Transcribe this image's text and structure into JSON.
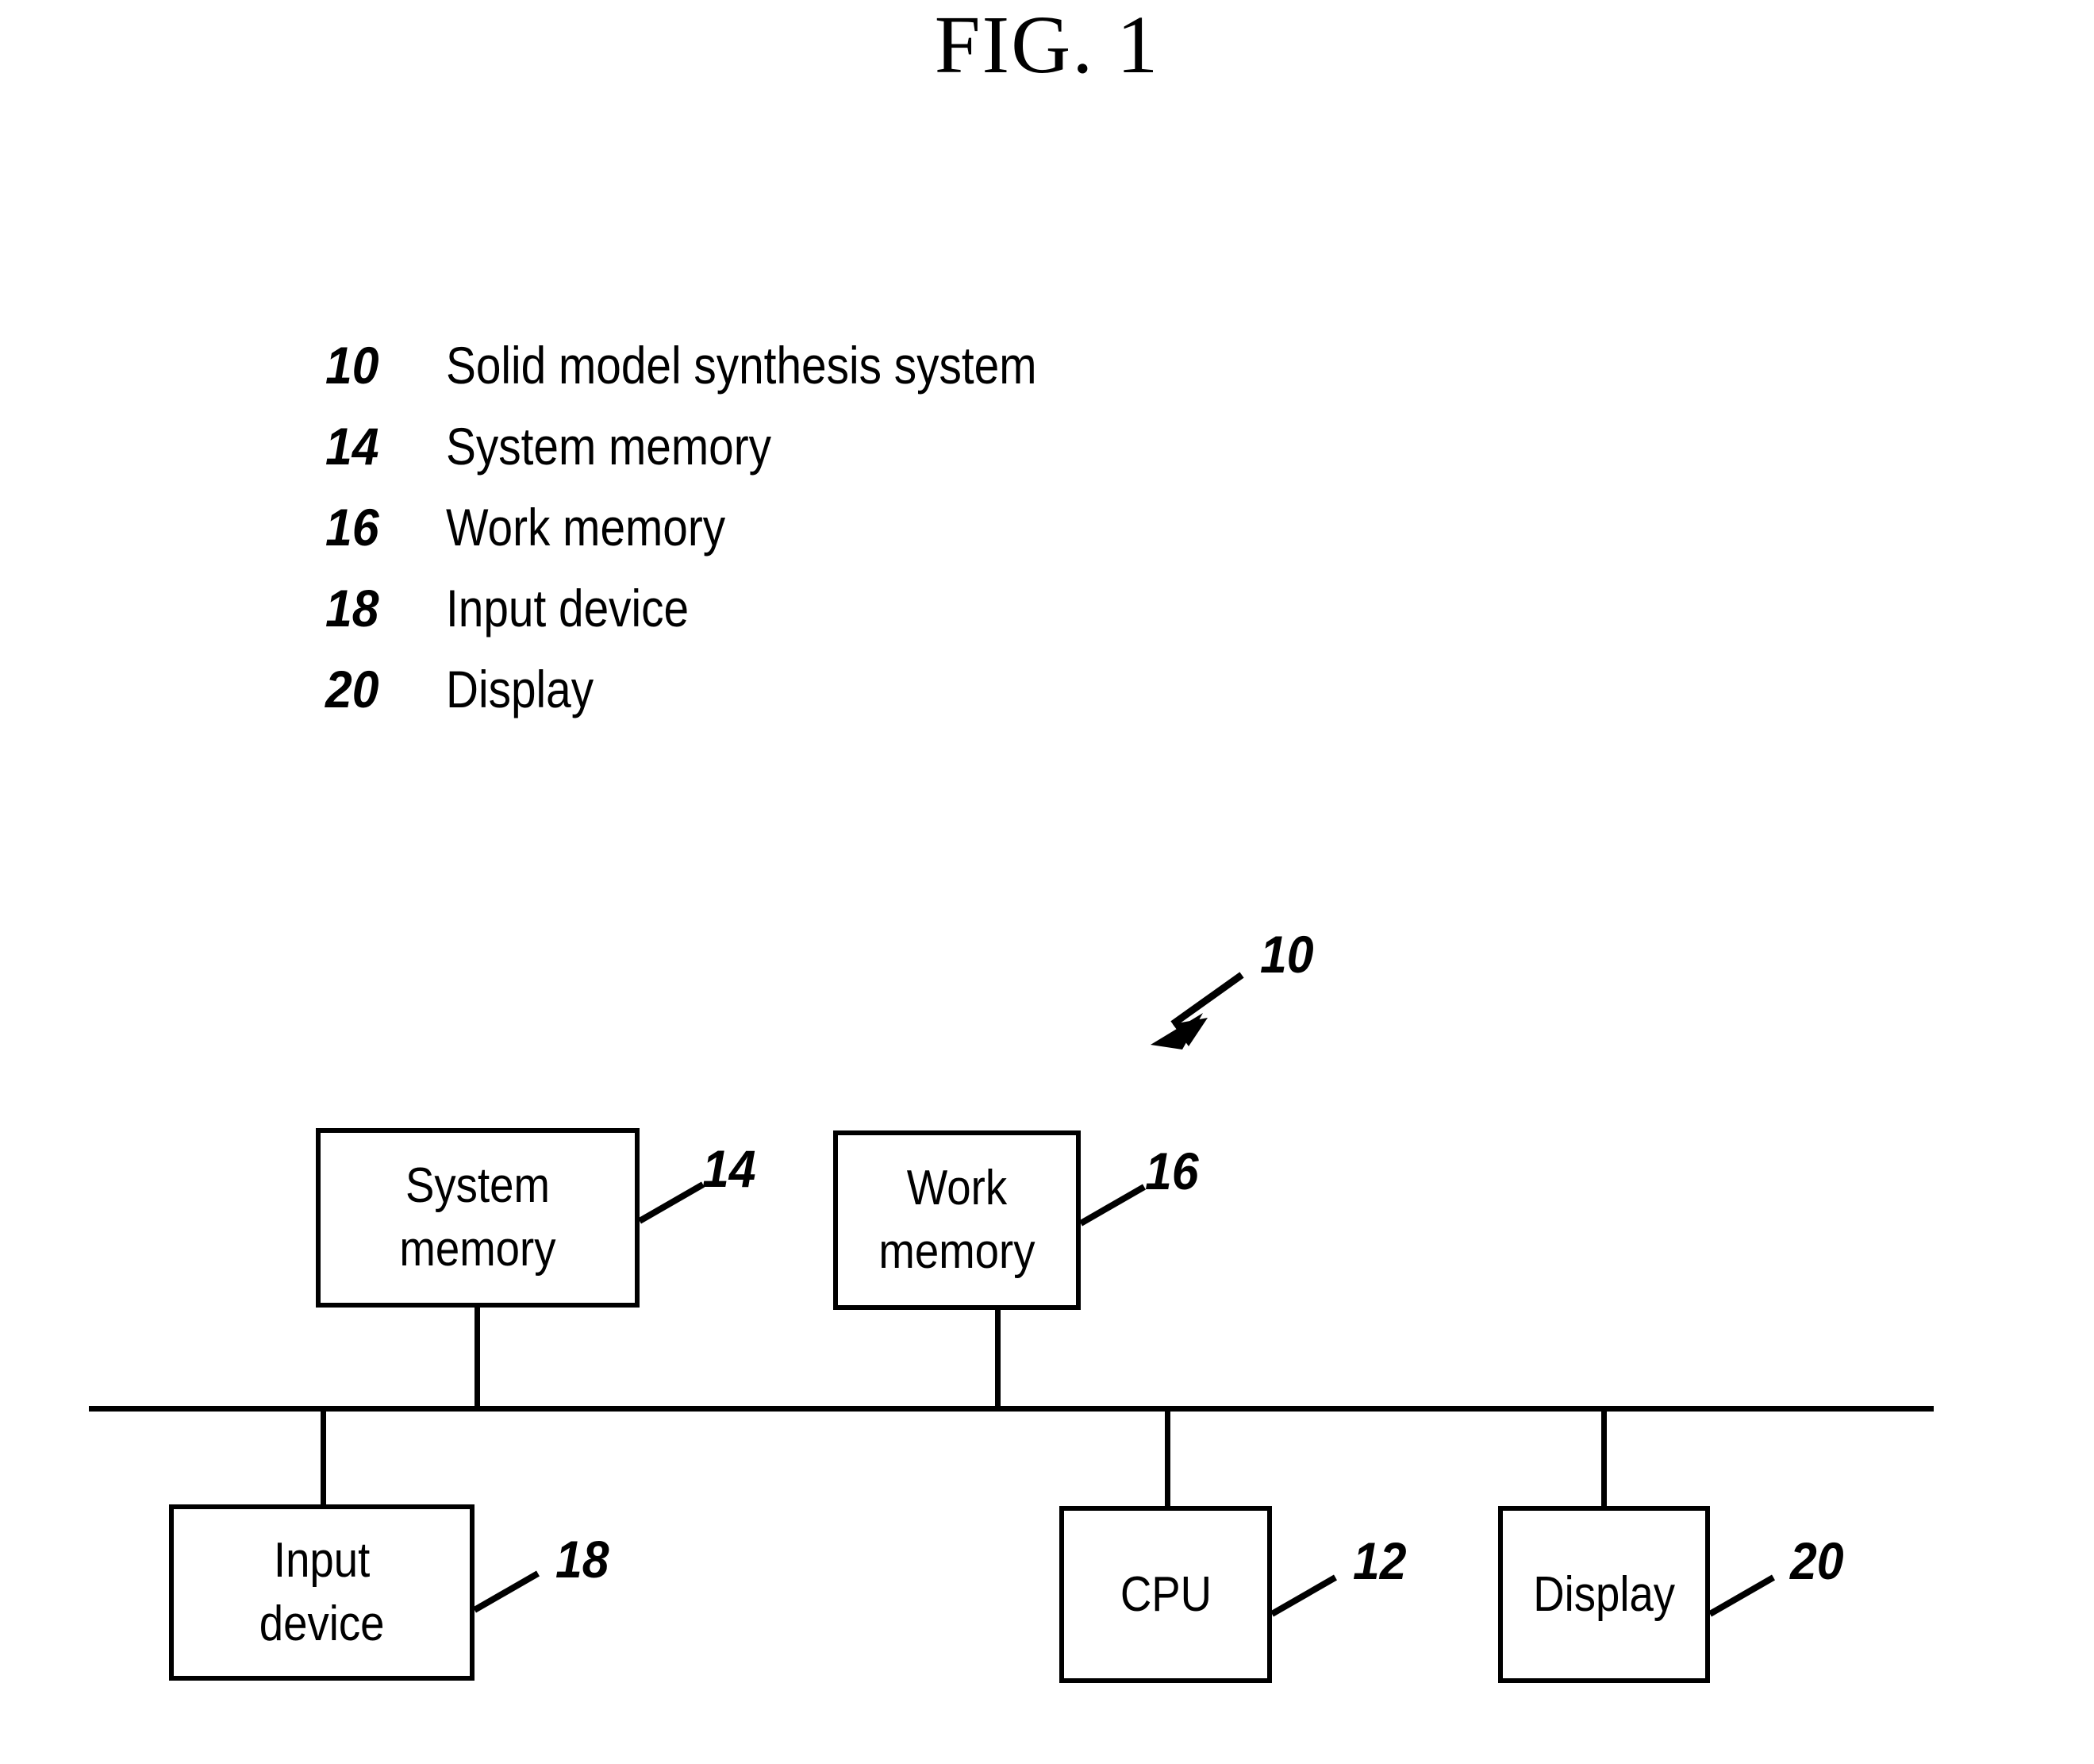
{
  "figure": {
    "title": "FIG. 1"
  },
  "legend": {
    "items": [
      {
        "number": "10",
        "label": "Solid model synthesis system"
      },
      {
        "number": "14",
        "label": "System memory"
      },
      {
        "number": "16",
        "label": "Work memory"
      },
      {
        "number": "18",
        "label": "Input device"
      },
      {
        "number": "20",
        "label": "Display"
      }
    ]
  },
  "diagram": {
    "system_callout": "10",
    "blocks": [
      {
        "label": "System\nmemory",
        "ref": "14"
      },
      {
        "label": "Work\nmemory",
        "ref": "16"
      },
      {
        "label": "Input\ndevice",
        "ref": "18"
      },
      {
        "label": "CPU",
        "ref": "12"
      },
      {
        "label": "Display",
        "ref": "20"
      }
    ]
  },
  "colors": {
    "ink": "#000000",
    "paper": "#ffffff"
  }
}
